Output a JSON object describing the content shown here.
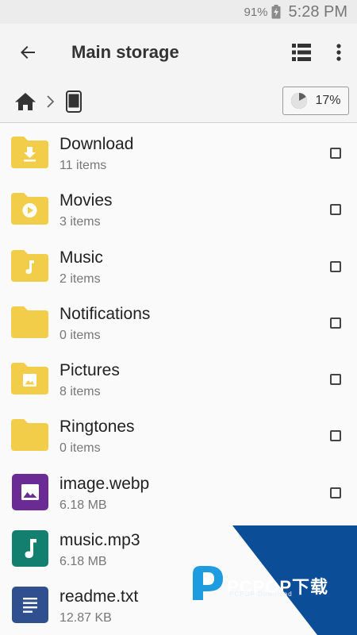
{
  "status_bar": {
    "battery": "91%",
    "time": "5:28 PM"
  },
  "app_bar": {
    "title": "Main storage"
  },
  "storage_chip": {
    "percent": "17%",
    "fraction_used": 0.17
  },
  "colors": {
    "folder": "#f2cd4a",
    "folder_symbol": "#ffffff",
    "image_file": "#6a2b94",
    "audio_file": "#137f6e",
    "text_file": "#2f4f8e",
    "watermark_blue": "#0b4e97"
  },
  "files": [
    {
      "name": "Download",
      "meta": "11 items",
      "icon": "download-folder-icon",
      "checkbox": true
    },
    {
      "name": "Movies",
      "meta": "3 items",
      "icon": "movies-folder-icon",
      "checkbox": true
    },
    {
      "name": "Music",
      "meta": "2 items",
      "icon": "music-folder-icon",
      "checkbox": true
    },
    {
      "name": "Notifications",
      "meta": "0 items",
      "icon": "folder-icon",
      "checkbox": true
    },
    {
      "name": "Pictures",
      "meta": "8 items",
      "icon": "pictures-folder-icon",
      "checkbox": true
    },
    {
      "name": "Ringtones",
      "meta": "0 items",
      "icon": "folder-icon",
      "checkbox": true
    },
    {
      "name": "image.webp",
      "meta": "6.18 MB",
      "icon": "image-file-icon",
      "checkbox": true
    },
    {
      "name": "music.mp3",
      "meta": "6.18 MB",
      "icon": "audio-file-icon",
      "checkbox": false
    },
    {
      "name": "readme.txt",
      "meta": "12.87 KB",
      "icon": "text-file-icon",
      "checkbox": false
    }
  ],
  "watermark": {
    "brand": "PCPOP下载",
    "sub": "PCPOP Download"
  }
}
